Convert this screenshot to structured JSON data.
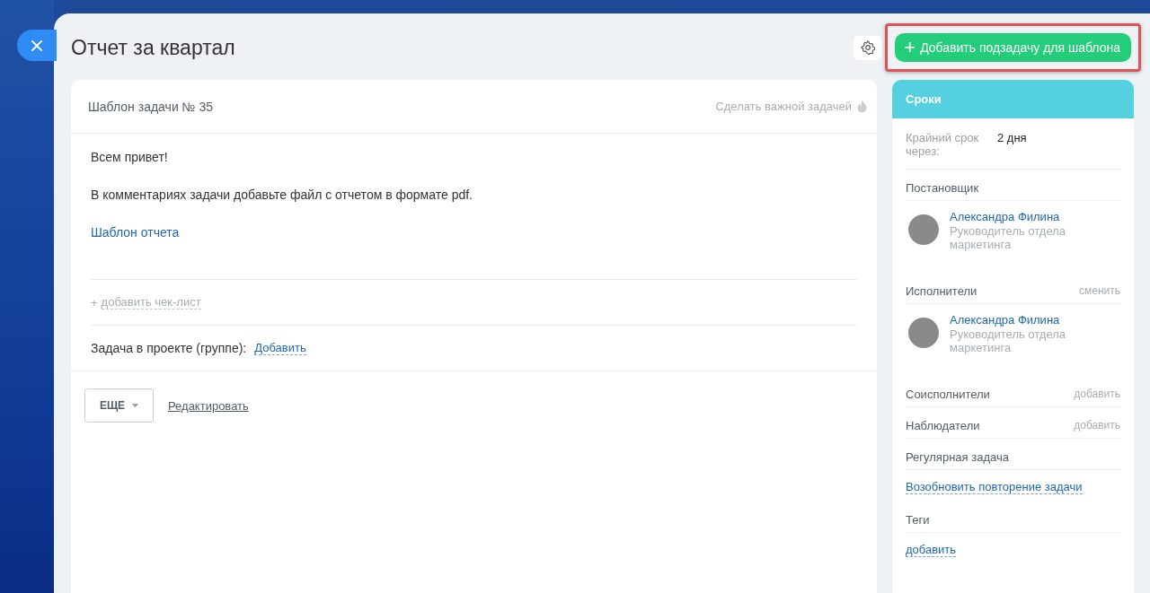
{
  "title": "Отчет за квартал",
  "add_subtask_button": {
    "icon": "+",
    "label": "Добавить подзадачу для шаблона",
    "highlighted": true
  },
  "task_card": {
    "header": "Шаблон задачи № 35",
    "important_action": "Сделать важной задачей",
    "paragraphs": [
      {
        "kind": "text",
        "text": "Всем привет!"
      },
      {
        "kind": "text",
        "text": "В комментариях задачи добавьте файл с отчетом в формате pdf."
      },
      {
        "kind": "link",
        "text": "Шаблон отчета"
      }
    ],
    "checklist": {
      "icon": "+",
      "label": "добавить чек-лист"
    },
    "project": {
      "label": "Задача в проекте (группе):",
      "link": "Добавить"
    },
    "footer": {
      "more_button": "ЕЩЕ",
      "edit_link": "Редактировать"
    }
  },
  "side_panel": {
    "header": "Сроки",
    "deadline": {
      "label": "Крайний срок через:",
      "value": "2 дня"
    },
    "sections": [
      {
        "kind": "person",
        "title": "Постановщик",
        "person": {
          "name": "Александра Филина",
          "role": "Руководитель отдела маркетинга"
        }
      },
      {
        "kind": "person",
        "title": "Исполнители",
        "action": "сменить",
        "person": {
          "name": "Александра Филина",
          "role": "Руководитель отдела маркетинга"
        }
      },
      {
        "kind": "plain",
        "title": "Соисполнители",
        "action": "добавить"
      },
      {
        "kind": "plain",
        "title": "Наблюдатели",
        "action": "добавить"
      },
      {
        "kind": "link",
        "title": "Регулярная задача",
        "link": "Возобновить повторение задачи"
      },
      {
        "kind": "link",
        "title": "Теги",
        "link": "добавить"
      }
    ]
  }
}
